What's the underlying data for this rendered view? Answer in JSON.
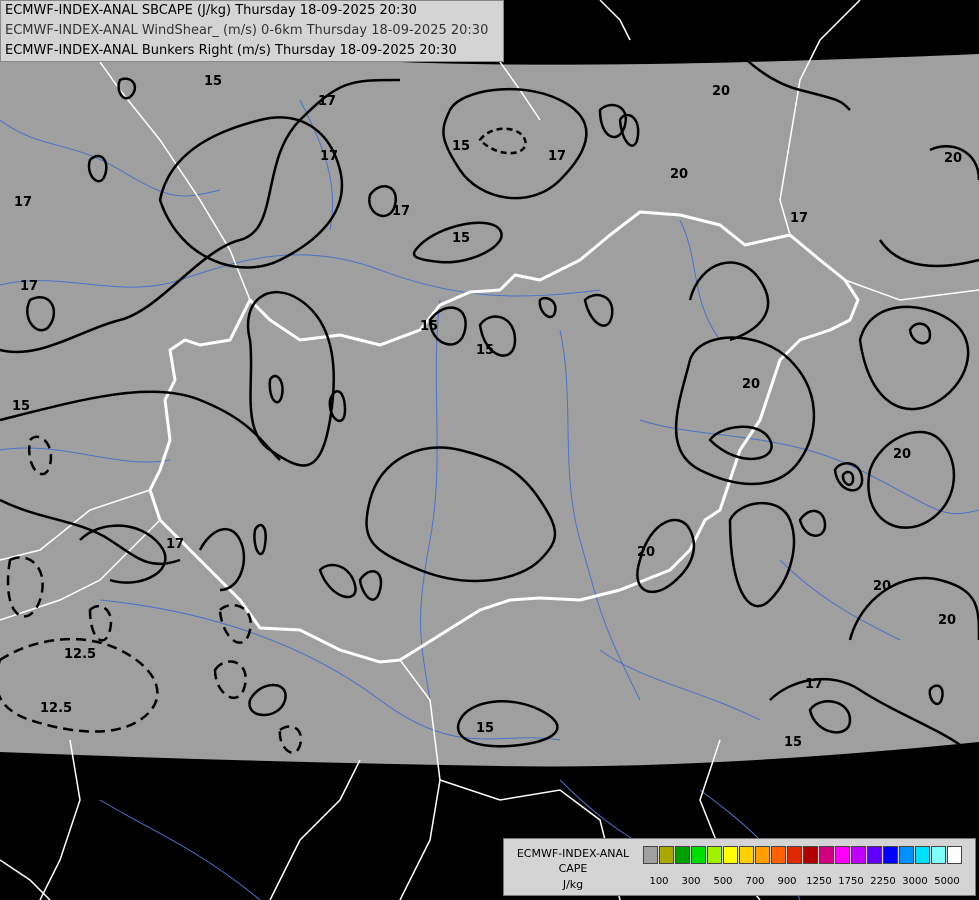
{
  "header": {
    "line1": "ECMWF-INDEX-ANAL SBCAPE (J/kg) Thursday 18-09-2025 20:30",
    "line2": "ECMWF-INDEX-ANAL WindShear_ (m/s) 0-6km Thursday 18-09-2025 20:30",
    "line3": "ECMWF-INDEX-ANAL Bunkers Right (m/s) Thursday 18-09-2025 20:30"
  },
  "legend": {
    "title1": "ECMWF-INDEX-ANAL",
    "title2": "CAPE",
    "title3": "J/kg",
    "colors": [
      "#a0a0a0",
      "#a8a800",
      "#00a000",
      "#00e000",
      "#a0f000",
      "#ffff00",
      "#ffd000",
      "#ffa000",
      "#ff6000",
      "#e02800",
      "#b00000",
      "#d00080",
      "#ff00ff",
      "#c000ff",
      "#6000ff",
      "#0000ff",
      "#0090ff",
      "#00e0ff",
      "#80ffff",
      "#ffffff"
    ],
    "ticks": [
      "100",
      "300",
      "500",
      "700",
      "900",
      "1250",
      "1750",
      "2250",
      "3000",
      "5000"
    ]
  },
  "contour_labels": [
    "15",
    "17",
    "20",
    "12.5"
  ],
  "colors": {
    "map_fill": "#9f9f9f",
    "outside": "#000000",
    "border": "#ffffff",
    "river": "#4a72c8",
    "contour": "#000000"
  }
}
